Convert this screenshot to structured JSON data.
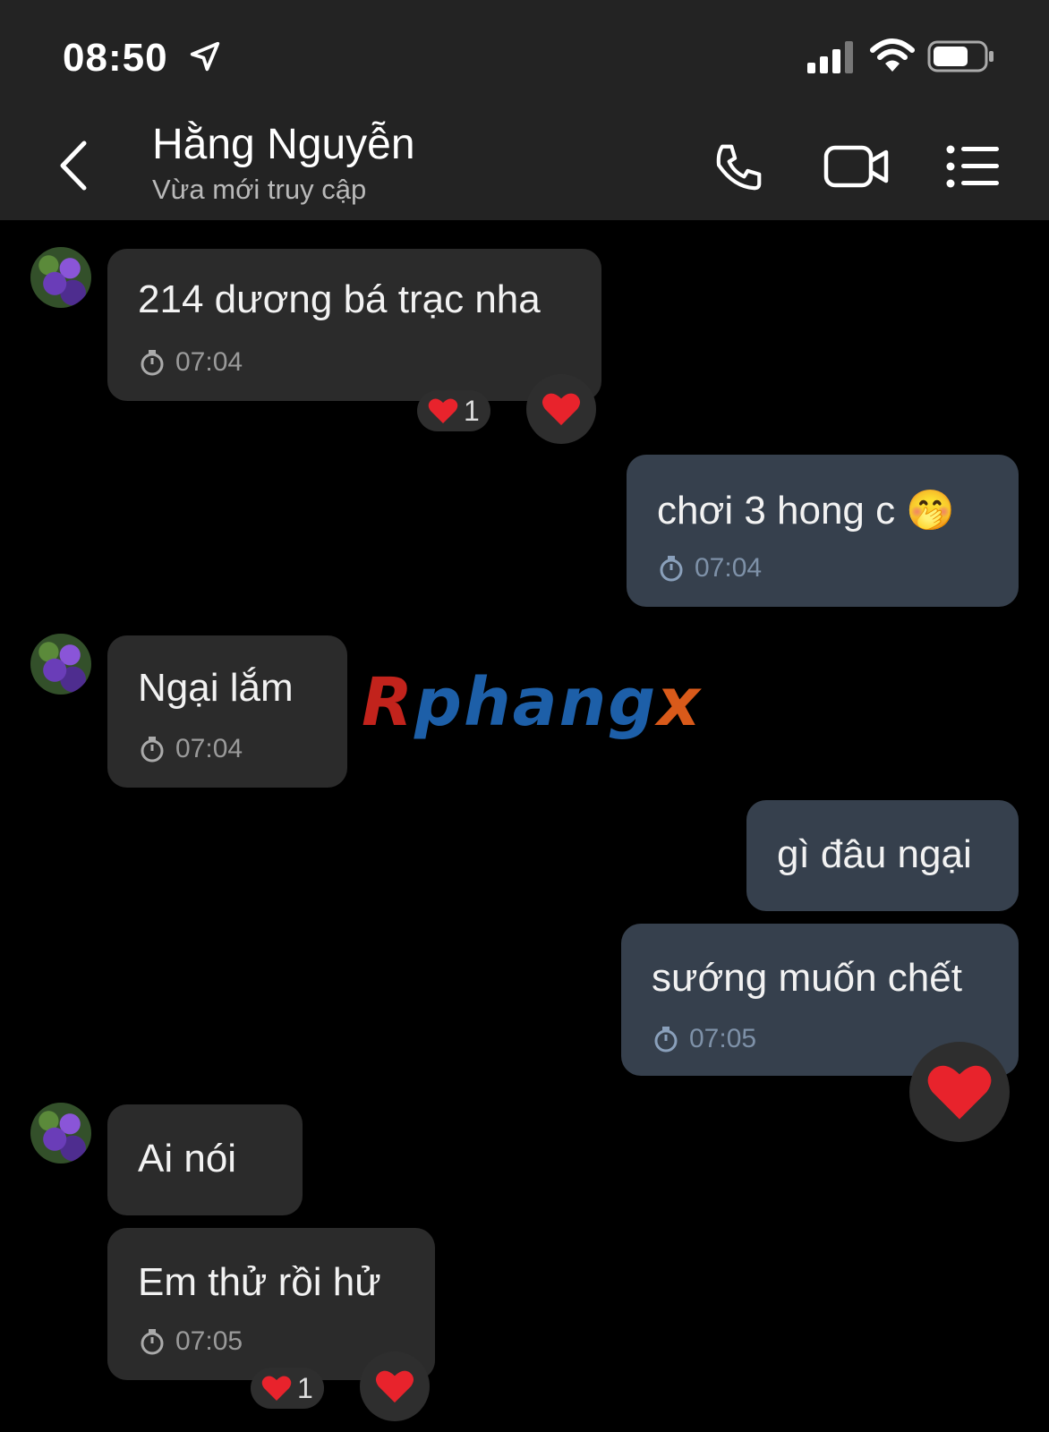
{
  "status_bar": {
    "time": "08:50"
  },
  "header": {
    "contact_name": "Hằng Nguyễn",
    "contact_status": "Vừa mới truy cập"
  },
  "watermark": {
    "text_main": "Rphang",
    "text_tail": "x"
  },
  "messages": [
    {
      "direction": "in",
      "text": "214 dương bá trạc nha",
      "time": "07:04",
      "reaction_count": "1"
    },
    {
      "direction": "out",
      "text": "chơi 3 hong c",
      "emoji": "🤭",
      "time": "07:04"
    },
    {
      "direction": "in",
      "text": "Ngại lắm",
      "time": "07:04"
    },
    {
      "direction": "out",
      "text": "gì đâu ngại"
    },
    {
      "direction": "out",
      "text": "sướng muốn chết",
      "time": "07:05"
    },
    {
      "direction": "in",
      "text": "Ai nói"
    },
    {
      "direction": "in",
      "text": "Em thử rồi hử",
      "time": "07:05",
      "reaction_count": "1"
    }
  ],
  "colors": {
    "incoming_bubble": "#2b2b2b",
    "outgoing_bubble": "#36404d",
    "heart": "#e8232c"
  }
}
